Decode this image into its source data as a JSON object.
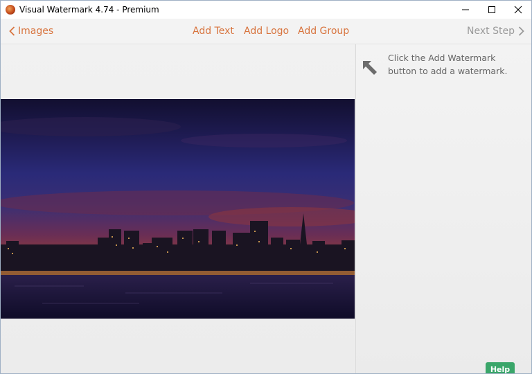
{
  "window": {
    "title": "Visual Watermark 4.74 - Premium",
    "icon": "app-logo-icon"
  },
  "toolbar": {
    "back_label": "Images",
    "add_text_label": "Add Text",
    "add_logo_label": "Add Logo",
    "add_group_label": "Add Group",
    "next_label": "Next Step"
  },
  "side_panel": {
    "hint": "Click the Add Watermark button to add a watermark.",
    "help_label": "Help"
  },
  "colors": {
    "accent": "#d8743e",
    "disabled": "#9a9a9a",
    "help_button": "#3aa66a",
    "background": "#efefef"
  },
  "icons": [
    "minimize-icon",
    "maximize-icon",
    "close-icon",
    "chevron-left-icon",
    "chevron-right-icon",
    "arrow-up-left-icon"
  ]
}
